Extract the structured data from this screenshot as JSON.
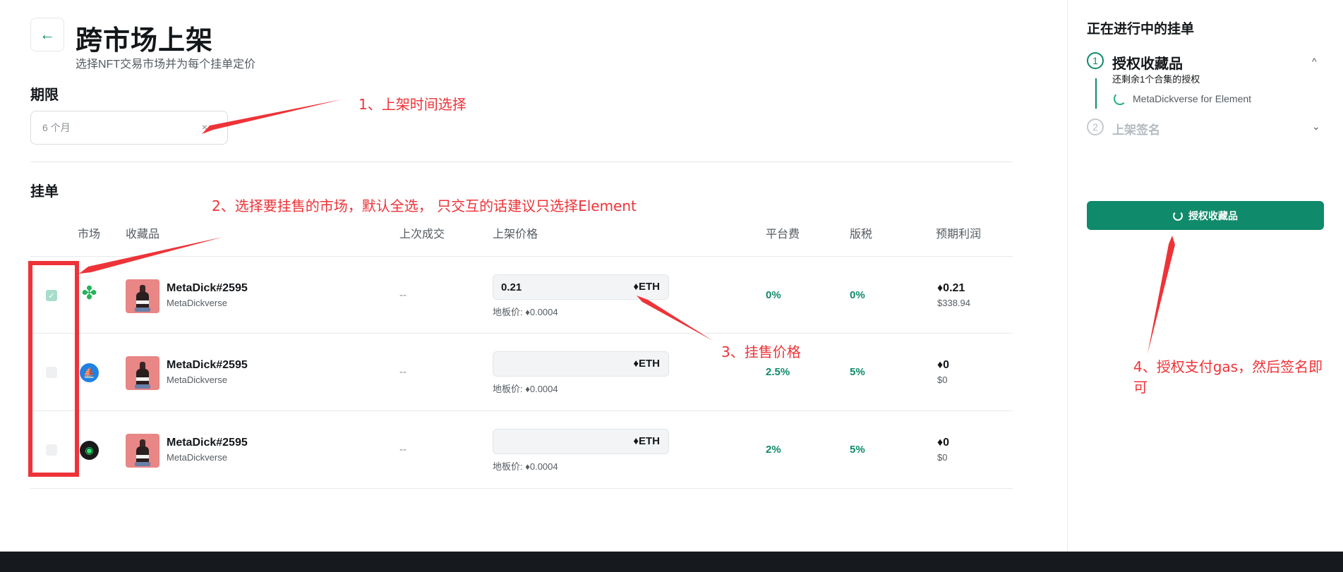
{
  "header": {
    "back_icon": "arrow-left-icon",
    "title": "跨市场上架",
    "subtitle": "选择NFT交易市场并为每个挂单定价"
  },
  "duration": {
    "label": "期限",
    "value": "6 个月",
    "clear": "×"
  },
  "listings": {
    "label": "挂单",
    "columns": [
      "市场",
      "收藏品",
      "上次成交",
      "上架价格",
      "平台费",
      "版税",
      "预期利润"
    ],
    "rows": [
      {
        "checked": true,
        "market_icon": "element-market-icon",
        "item_name": "MetaDick#2595",
        "collection": "MetaDickverse",
        "last_sale": "--",
        "price": "0.21",
        "currency": "♦ETH",
        "floor": "地板价: ♦0.0004",
        "platform_fee": "0%",
        "royalty": "0%",
        "profit": "♦0.21",
        "profit_usd": "$338.94"
      },
      {
        "checked": false,
        "market_icon": "opensea-market-icon",
        "item_name": "MetaDick#2595",
        "collection": "MetaDickverse",
        "last_sale": "--",
        "price": "",
        "currency": "♦ETH",
        "floor": "地板价: ♦0.0004",
        "platform_fee": "2.5%",
        "royalty": "5%",
        "profit": "♦0",
        "profit_usd": "$0"
      },
      {
        "checked": false,
        "market_icon": "looksrare-market-icon",
        "item_name": "MetaDick#2595",
        "collection": "MetaDickverse",
        "last_sale": "--",
        "price": "",
        "currency": "♦ETH",
        "floor": "地板价: ♦0.0004",
        "platform_fee": "2%",
        "royalty": "5%",
        "profit": "♦0",
        "profit_usd": "$0"
      }
    ]
  },
  "sidebar": {
    "title": "正在进行中的挂单",
    "step1": {
      "number": "1",
      "title": "授权收藏品",
      "subtitle": "还剩余1个合集的授权",
      "sub_item": "MetaDickverse for Element",
      "chevron": "^"
    },
    "step2": {
      "number": "2",
      "title": "上架签名",
      "chevron": "⌄"
    },
    "approve_button": "授权收藏品"
  },
  "annotations": {
    "a1": "1、上架时间选择",
    "a2": "2、选择要挂售的市场，默认全选， 只交互的话建议只选择Element",
    "a3": "3、挂售价格",
    "a4_line1": "4、授权支付gas，然后签名即",
    "a4_line2": "可",
    "color": "#ee3338"
  },
  "colors": {
    "accent": "#0f8a6a",
    "annotation": "#ee3338",
    "footer": "#161a1f"
  }
}
